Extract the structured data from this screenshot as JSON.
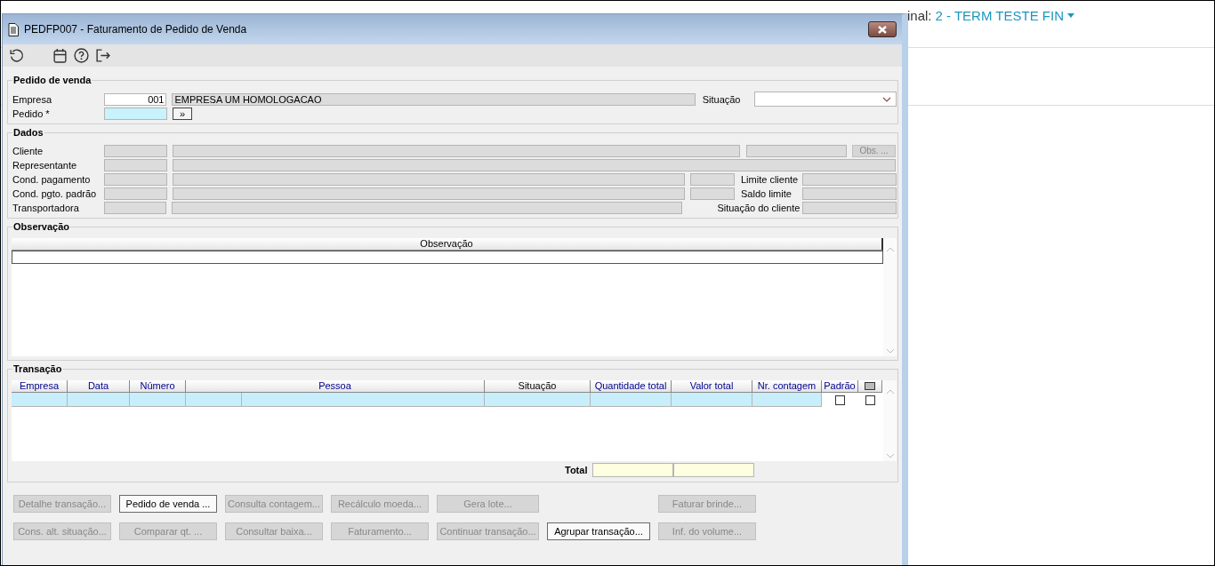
{
  "background": {
    "terminal_label": "inal:",
    "terminal_value": "2 - TERM TESTE FIN"
  },
  "window": {
    "title": "PEDFP007 - Faturamento de Pedido de Venda"
  },
  "pedido_de_venda": {
    "title": "Pedido de venda",
    "empresa_label": "Empresa",
    "empresa_code": "001",
    "empresa_name": "EMPRESA UM HOMOLOGACAO",
    "situacao_label": "Situação",
    "pedido_label": "Pedido *",
    "search_button": "»"
  },
  "dados": {
    "title": "Dados",
    "obs_button": {
      "label": "Obs. ...",
      "disabled": true
    },
    "rows": [
      {
        "kind": "extra",
        "label": "Cliente"
      },
      {
        "kind": "full",
        "label": "Representante"
      },
      {
        "kind": "split",
        "label": "Cond. pagamento",
        "side_label": "Limite cliente"
      },
      {
        "kind": "split",
        "label": "Cond. pgto. padrão",
        "side_label": "Saldo limite"
      },
      {
        "kind": "side",
        "label": "Transportadora",
        "side_label": "Situação do cliente"
      }
    ]
  },
  "observacao": {
    "title": "Observação",
    "columns": [
      "Observação"
    ]
  },
  "transacao": {
    "title": "Transação",
    "columns": [
      {
        "label": "Empresa",
        "editable": true
      },
      {
        "label": "Data",
        "editable": true
      },
      {
        "label": "Número",
        "editable": true
      },
      {
        "label": "Pessoa",
        "editable": true
      },
      {
        "label": "Situação",
        "editable": false
      },
      {
        "label": "Quantidade total",
        "editable": true
      },
      {
        "label": "Valor total",
        "editable": true
      },
      {
        "label": "Nr. contagem",
        "editable": true
      },
      {
        "label": "Padrão",
        "editable": true
      }
    ],
    "select_all_checked": false,
    "rows": [
      {
        "padrao_checked": false,
        "marked": false
      }
    ],
    "total_label": "Total"
  },
  "buttons": [
    [
      {
        "kind": "button",
        "label": "Detalhe transação...",
        "disabled": true
      },
      {
        "kind": "button",
        "label": "Pedido de venda ...",
        "disabled": false
      },
      {
        "kind": "button",
        "label": "Consulta contagem...",
        "disabled": true
      },
      {
        "kind": "button",
        "label": "Recálculo moeda...",
        "disabled": true
      },
      {
        "kind": "button",
        "label": "Gera lote...",
        "disabled": true
      },
      {
        "kind": "blank"
      },
      {
        "kind": "button",
        "label": "Faturar brinde...",
        "disabled": true
      }
    ],
    [
      {
        "kind": "button",
        "label": "Cons. alt. situação...",
        "disabled": true
      },
      {
        "kind": "button",
        "label": "Comparar qt. ...",
        "disabled": true
      },
      {
        "kind": "button",
        "label": "Consultar baixa...",
        "disabled": true
      },
      {
        "kind": "button",
        "label": "Faturamento...",
        "disabled": true
      },
      {
        "kind": "button",
        "label": "Continuar transação...",
        "disabled": true
      },
      {
        "kind": "button",
        "label": "Agrupar transação...",
        "disabled": false
      },
      {
        "kind": "button",
        "label": "Inf. do volume...",
        "disabled": true
      }
    ]
  ]
}
